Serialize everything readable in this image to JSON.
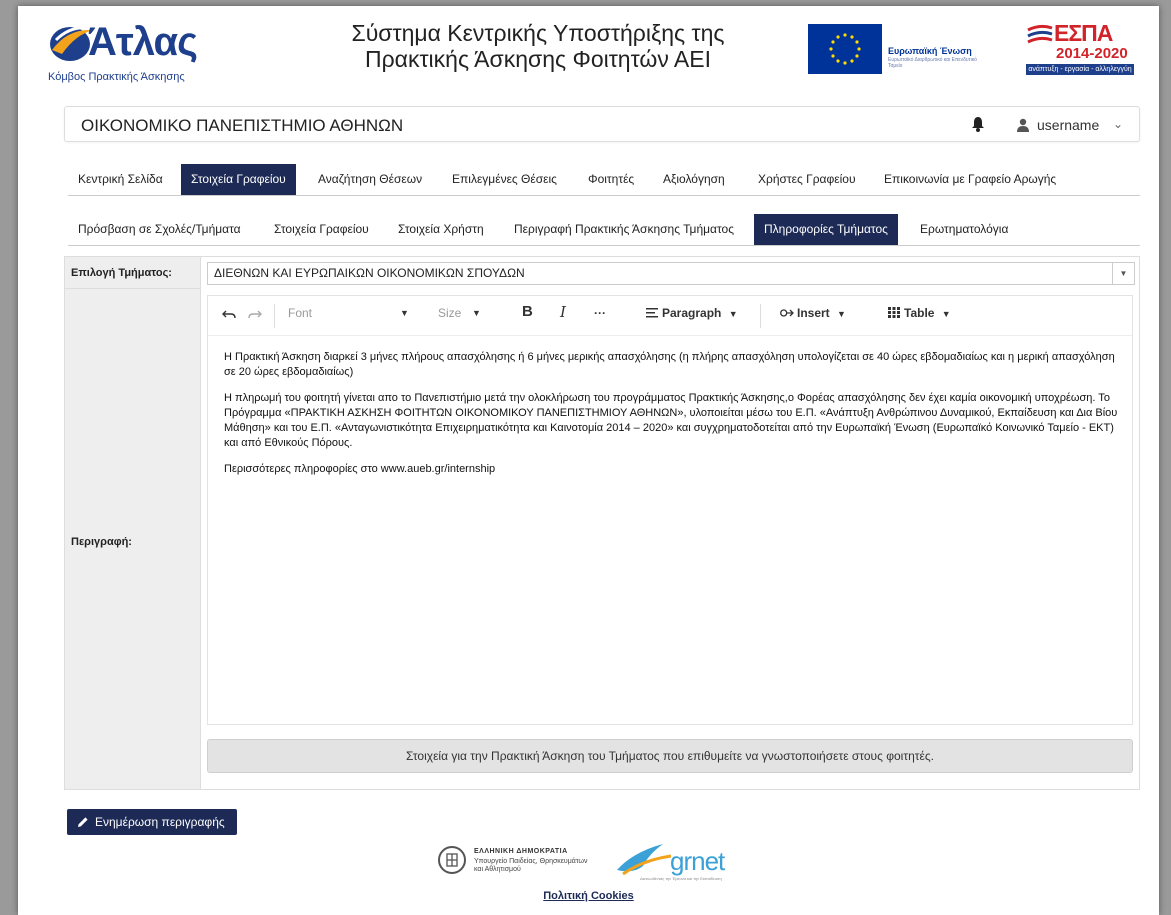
{
  "header": {
    "logo_word": "Άτλας",
    "logo_subtitle": "Κόμβος Πρακτικής Άσκησης",
    "title_line1": "Σύστημα Κεντρικής Υποστήριξης της",
    "title_line2": "Πρακτικής Άσκησης Φοιτητών ΑΕΙ",
    "eu_label": "Ευρωπαϊκή Ένωση",
    "eu_sub": "Ευρωπαϊκό Διαρθρωτικό και Επενδυτικό Ταμείο",
    "espa_title": "ΕΣΠΑ",
    "espa_years": "2014-2020",
    "espa_motto": "ανάπτυξη - εργασία - αλληλεγγύη"
  },
  "university_bar": {
    "name": "ΟΙΚΟΝΟΜΙΚΟ ΠΑΝΕΠΙΣΤΗΜΙΟ ΑΘΗΝΩΝ",
    "username": "username"
  },
  "main_tabs": [
    {
      "label": "Κεντρική Σελίδα"
    },
    {
      "label": "Στοιχεία Γραφείου"
    },
    {
      "label": "Αναζήτηση Θέσεων"
    },
    {
      "label": "Επιλεγμένες Θέσεις"
    },
    {
      "label": "Φοιτητές"
    },
    {
      "label": "Αξιολόγηση"
    },
    {
      "label": "Χρήστες Γραφείου"
    },
    {
      "label": "Επικοινωνία με Γραφείο Αρωγής"
    }
  ],
  "sub_tabs": [
    {
      "label": "Πρόσβαση σε Σχολές/Τμήματα"
    },
    {
      "label": "Στοιχεία Γραφείου"
    },
    {
      "label": "Στοιχεία Χρήστη"
    },
    {
      "label": "Περιγραφή Πρακτικής Άσκησης Τμήματος"
    },
    {
      "label": "Πληροφορίες Τμήματος"
    },
    {
      "label": "Ερωτηματολόγια"
    }
  ],
  "form": {
    "department_label": "Επιλογή Τμήματος:",
    "department_value": "ΔΙΕΘΝΩΝ ΚΑΙ ΕΥΡΩΠΑΙΚΩΝ ΟΙΚΟΝΟΜΙΚΩΝ ΣΠΟΥΔΩΝ",
    "description_label": "Περιγραφή:",
    "toolbar": {
      "font": "Font",
      "size": "Size",
      "bold": "B",
      "italic": "I",
      "more": "···",
      "paragraph": "Paragraph",
      "insert": "Insert",
      "table": "Table"
    },
    "paragraphs": [
      "Η Πρακτική Άσκηση διαρκεί 3 μήνες πλήρους απασχόλησης ή 6 μήνες μερικής απασχόλησης (η πλήρης απασχόληση υπολογίζεται σε 40 ώρες εβδομαδιαίως και η μερική απασχόληση σε 20 ώρες εβδομαδιαίως)",
      "Η πληρωμή του φοιτητή γίνεται απο το Πανεπιστήμιο μετά την ολοκλήρωση του προγράμματος Πρακτικής Άσκησης,ο Φορέας απασχόλησης δεν έχει καμία οικονομική υποχρέωση. Το Πρόγραμμα «ΠΡΑΚΤΙΚΗ ΑΣΚΗΣΗ ΦΟΙΤΗΤΩΝ ΟΙΚΟΝΟΜΙΚΟΥ ΠΑΝΕΠΙΣΤΗΜΙΟΥ ΑΘΗΝΩΝ», υλοποιείται μέσω του Ε.Π. «Ανάπτυξη Ανθρώπινου Δυναμικού, Εκπαίδευση και Δια Βίου Μάθηση» και του Ε.Π. «Ανταγωνιστικότητα Επιχειρηματικότητα και Καινοτομία 2014 – 2020» και συγχρηματοδοτείται από την Ευρωπαϊκή Ένωση (Ευρωπαϊκό Κοινωνικό Ταμείο - ΕΚΤ) και από Εθνικούς Πόρους.",
      "Περισσότερες πληροφορίες στο www.aueb.gr/internship"
    ],
    "info_note": "Στοιχεία για την Πρακτική Άσκηση του Τμήματος που επιθυμείτε να γνωστοποιήσετε στους φοιτητές."
  },
  "update_button": "Ενημέρωση περιγραφής",
  "footer": {
    "gov_title": "ΕΛΛΗΝΙΚΗ ΔΗΜΟΚΡΑΤΙΑ",
    "gov_ministry": "Υπουργείο Παιδείας, Θρησκευμάτων και Αθλητισμού",
    "grnet": "grnet",
    "grnet_sub": "Δικτυωθέντας την Έρευνα και την Εκπαίδευση",
    "cookies": "Πολιτική Cookies"
  },
  "colors": {
    "nav_active": "#1c2a55",
    "brand_blue": "#1e3f8c",
    "espa_red": "#d2232a",
    "grnet_blue": "#3ba1d6"
  }
}
